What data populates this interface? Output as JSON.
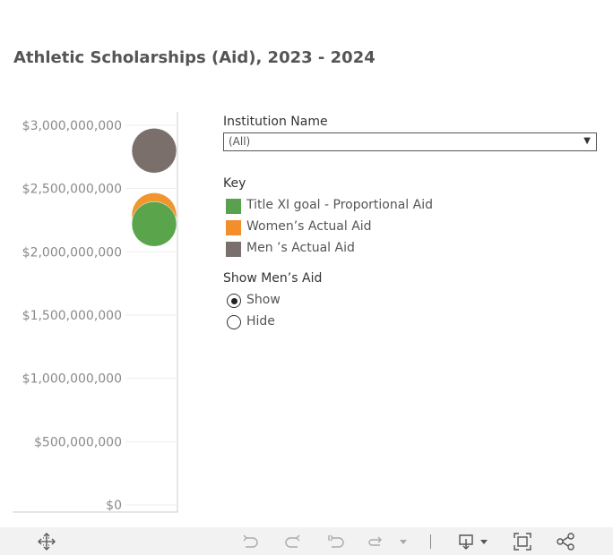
{
  "title": "Athletic Scholarships (Aid), 2023 - 2024",
  "chart_data": {
    "type": "scatter",
    "y_axis": {
      "range": [
        0,
        3000000000
      ],
      "ticks": [
        0,
        500000000,
        1000000000,
        1500000000,
        2000000000,
        2500000000,
        3000000000
      ],
      "tick_labels": [
        "$0",
        "$500,000,000",
        "$1,000,000,000",
        "$1,500,000,000",
        "$2,000,000,000",
        "$2,500,000,000",
        "$3,000,000,000"
      ]
    },
    "grid": true,
    "points": [
      {
        "series": "Men ’s Actual Aid",
        "y": 2800000000,
        "color": "#7b6f6c"
      },
      {
        "series": "Women's Actual Aid",
        "y": 2290000000,
        "color": "#f0962f"
      },
      {
        "series": "Title XI goal - Proportional Aid",
        "y": 2220000000,
        "color": "#5aa54c"
      }
    ]
  },
  "filter": {
    "label": "Institution Name",
    "value": "(All)"
  },
  "key": {
    "title": "Key",
    "items": [
      {
        "label": "Title XI goal - Proportional Aid",
        "color": "#59a14f"
      },
      {
        "label": "Women’s Actual Aid",
        "color": "#f28e2b"
      },
      {
        "label": "Men ’s Actual Aid",
        "color": "#79706e"
      }
    ]
  },
  "show_mens_aid": {
    "title": "Show Men’s Aid",
    "options": [
      "Show",
      "Hide"
    ],
    "selected": "Show"
  },
  "toolbar": {
    "icons": [
      "move-icon",
      "undo-icon",
      "redo-icon",
      "revert-icon",
      "refresh-icon",
      "pause-dropdown-icon",
      "download-icon",
      "fullscreen-icon",
      "share-icon"
    ]
  }
}
